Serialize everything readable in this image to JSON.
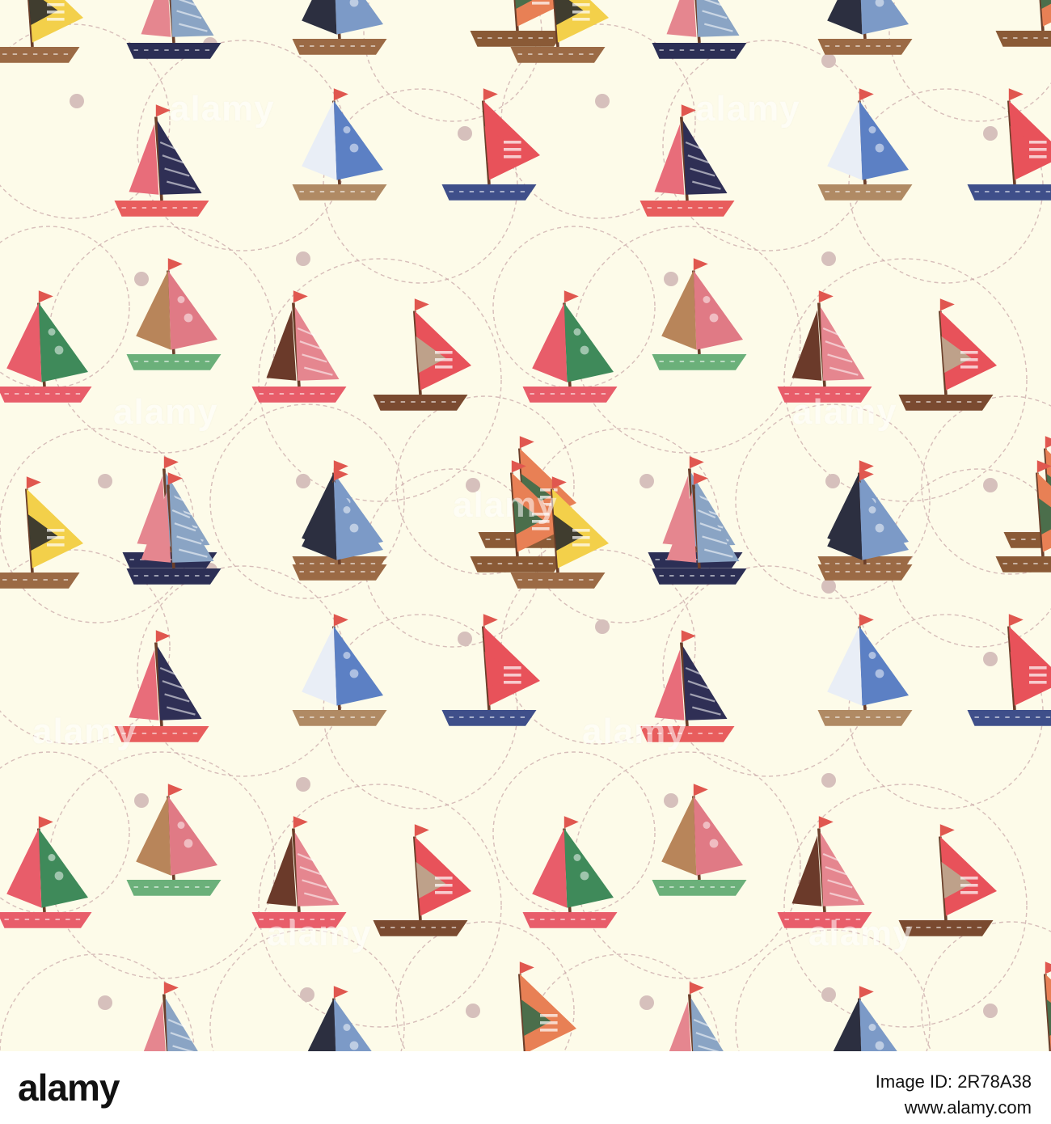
{
  "image": {
    "kind": "seamless sailboat pattern",
    "background_color": "#fdfbe9",
    "dash_color": "#c9a8a8",
    "dot_color": "#d6c0bc"
  },
  "watermark": {
    "text": "alamy"
  },
  "footer": {
    "brand": "alamy",
    "id_line1": "Image ID: 2R78A38",
    "id_line2": "www.alamy.com"
  }
}
